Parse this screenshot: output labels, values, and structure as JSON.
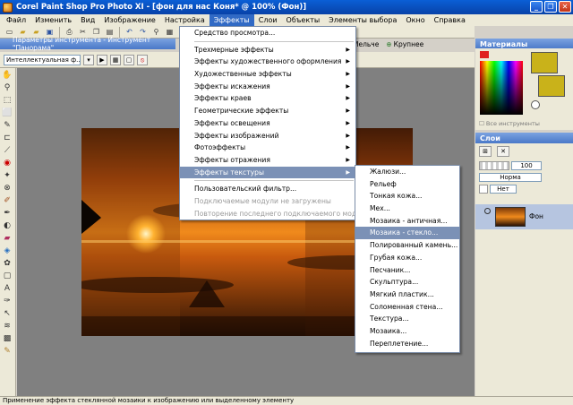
{
  "window": {
    "title": "Corel Paint Shop Pro Photo XI - [фон для нас Коня* @ 100% (Фон)]",
    "minimize": "_",
    "restore": "❐",
    "close": "✕"
  },
  "menubar": [
    "Файл",
    "Изменить",
    "Вид",
    "Изображение",
    "Настройка",
    "Эффекты",
    "Слои",
    "Объекты",
    "Элементы выбора",
    "Окно",
    "Справка"
  ],
  "tool_options_title": "Параметры инструмента - Инструмент \"Панорама\"",
  "view_tabs": {
    "smaller": "Мельче",
    "larger": "Крупнее"
  },
  "preset": "Интеллектуальная ф...",
  "effects_menu": {
    "items": [
      {
        "label": "Средство просмотра...",
        "submenu": false,
        "state": "normal"
      },
      {
        "sep": true
      },
      {
        "label": "Трехмерные эффекты",
        "submenu": true,
        "state": "normal"
      },
      {
        "label": "Эффекты художественного оформления",
        "submenu": true,
        "state": "normal"
      },
      {
        "label": "Художественные эффекты",
        "submenu": true,
        "state": "normal"
      },
      {
        "label": "Эффекты искажения",
        "submenu": true,
        "state": "normal"
      },
      {
        "label": "Эффекты краев",
        "submenu": true,
        "state": "normal"
      },
      {
        "label": "Геометрические эффекты",
        "submenu": true,
        "state": "normal"
      },
      {
        "label": "Эффекты освещения",
        "submenu": true,
        "state": "normal"
      },
      {
        "label": "Эффекты изображений",
        "submenu": true,
        "state": "normal"
      },
      {
        "label": "Фотоэффекты",
        "submenu": true,
        "state": "normal"
      },
      {
        "label": "Эффекты отражения",
        "submenu": true,
        "state": "normal"
      },
      {
        "label": "Эффекты текстуры",
        "submenu": true,
        "state": "highlighted"
      },
      {
        "sep": true
      },
      {
        "label": "Пользовательский фильтр...",
        "submenu": false,
        "state": "normal"
      },
      {
        "label": "Подключаемые модули не загружены",
        "submenu": false,
        "state": "disabled"
      },
      {
        "label": "Повторение последнего подключаемого модуля",
        "submenu": false,
        "state": "disabled"
      }
    ]
  },
  "texture_menu": {
    "items": [
      {
        "label": "Жалюзи...",
        "state": "normal"
      },
      {
        "label": "Рельеф",
        "state": "normal"
      },
      {
        "label": "Тонкая кожа...",
        "state": "normal"
      },
      {
        "label": "Мех...",
        "state": "normal"
      },
      {
        "label": "Мозаика - античная...",
        "state": "normal"
      },
      {
        "label": "Мозаика - стекло...",
        "state": "highlighted"
      },
      {
        "label": "Полированный камень...",
        "state": "normal"
      },
      {
        "label": "Грубая кожа...",
        "state": "normal"
      },
      {
        "label": "Песчаник...",
        "state": "normal"
      },
      {
        "label": "Скульптура...",
        "state": "normal"
      },
      {
        "label": "Мягкий пластик...",
        "state": "normal"
      },
      {
        "label": "Соломенная стена...",
        "state": "normal"
      },
      {
        "label": "Текстура...",
        "state": "normal"
      },
      {
        "label": "Мозаика...",
        "state": "normal"
      },
      {
        "label": "Переплетение...",
        "state": "normal"
      }
    ]
  },
  "materials": {
    "title": "Материалы",
    "all_tools": "Все инструменты"
  },
  "layers": {
    "title": "Слои",
    "opacity": "100",
    "blend": "Норма",
    "lock": "Нет",
    "layer_name": "Фон"
  },
  "status": "Применение эффекта стеклянной мозаики к изображению или выделенному элементу",
  "colors": {
    "accent": "#316ac5",
    "menu_highlight": "#7b91b6",
    "material_gold": "#c9b21a"
  }
}
